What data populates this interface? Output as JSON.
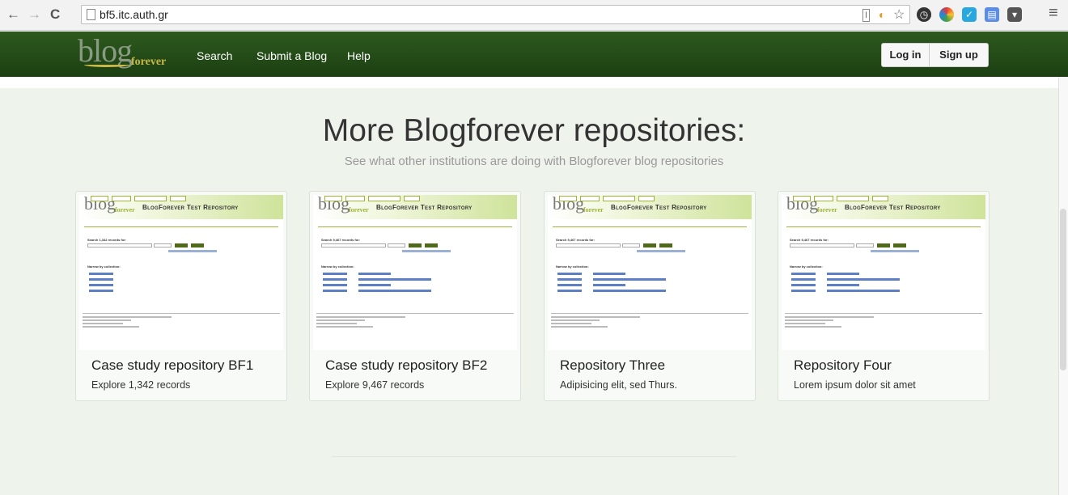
{
  "browser": {
    "url": "bf5.itc.auth.gr",
    "back_glyph": "←",
    "forward_glyph": "→",
    "reload_glyph": "C",
    "menu_glyph": "≡",
    "star_glyph": "☆",
    "extensions": [
      "reader-icon",
      "star-icon",
      "clock-icon",
      "color-picker-icon",
      "chat-icon",
      "bookmark-icon",
      "pocket-icon"
    ]
  },
  "site": {
    "logo_blog": "blog",
    "logo_forever": "forever",
    "nav": [
      "Search",
      "Submit a Blog",
      "Help"
    ],
    "login_label": "Log in",
    "signup_label": "Sign up",
    "header_color": "#2d5a1e"
  },
  "main": {
    "title": "More Blogforever repositories:",
    "subtitle": "See what other institutions are doing with Blogforever blog repositories"
  },
  "cards": [
    {
      "title": "Case study repository BF1",
      "description": "Explore 1,342 records",
      "thumb_site_title": "BlogForever Test Repository",
      "thumb_search_label": "Search 1,342 records for:",
      "thumb_narrow_label": "Narrow by collection:"
    },
    {
      "title": "Case study repository BF2",
      "description": "Explore 9,467 records",
      "thumb_site_title": "BlogForever Test Repository",
      "thumb_search_label": "Search 9,467 records for:",
      "thumb_narrow_label": "Narrow by collection:"
    },
    {
      "title": "Repository Three",
      "description": "Adipisicing elit, sed Thurs.",
      "thumb_site_title": "BlogForever Test Repository",
      "thumb_search_label": "Search 9,467 records for:",
      "thumb_narrow_label": "Narrow by collection:"
    },
    {
      "title": "Repository Four",
      "description": "Lorem ipsum dolor sit amet",
      "thumb_site_title": "BlogForever Test Repository",
      "thumb_search_label": "Search 9,467 records for:",
      "thumb_narrow_label": "Narrow by collection:"
    }
  ]
}
